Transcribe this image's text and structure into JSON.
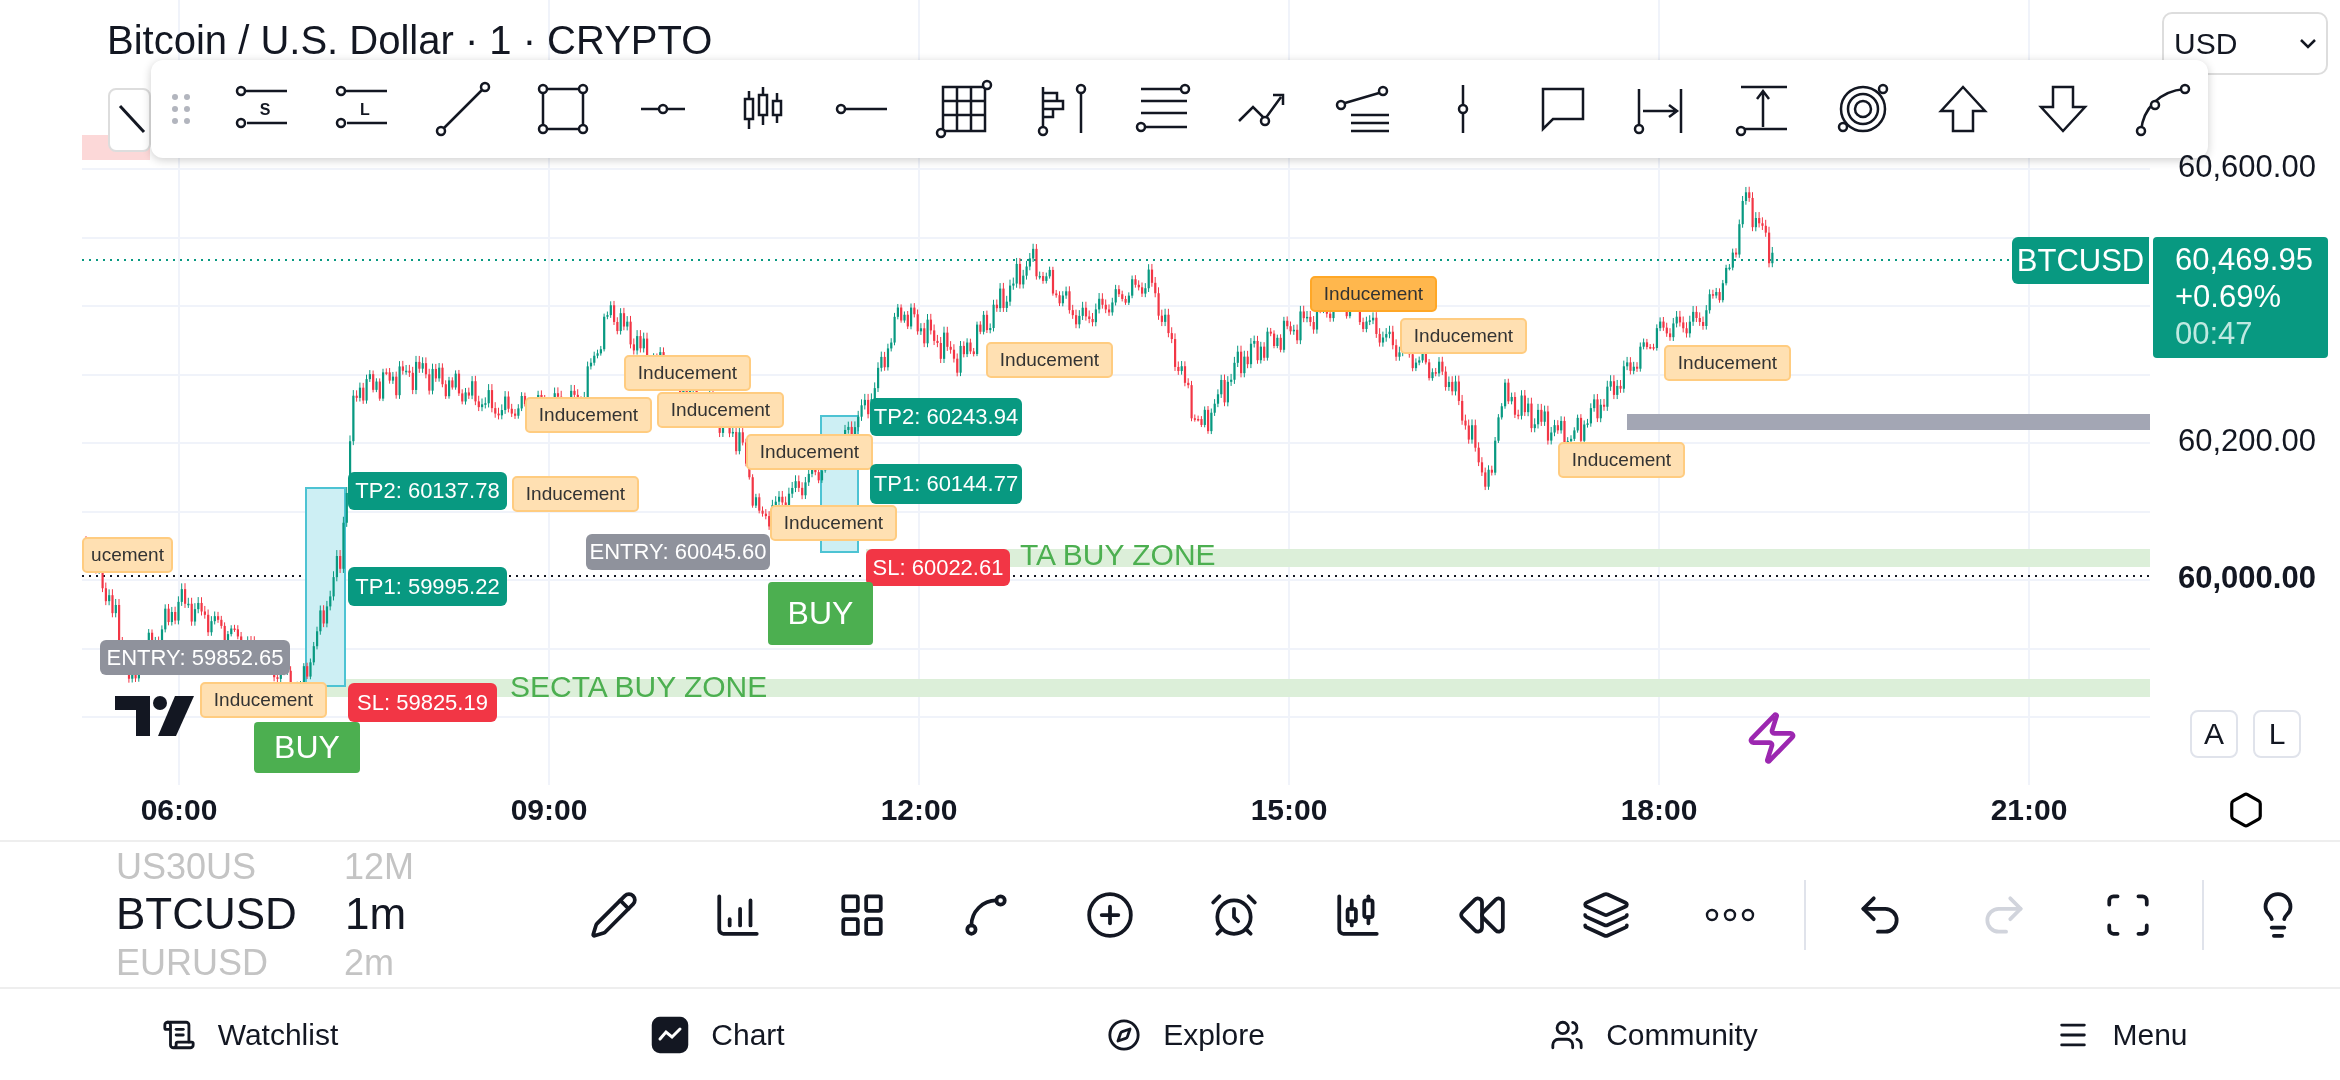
{
  "header": {
    "title": "Bitcoin / U.S. Dollar · 1 · CRYPTO",
    "currency": "USD"
  },
  "drawing_toolbar": {
    "tool_letters": [
      "S",
      "L"
    ]
  },
  "chart": {
    "symbol_tag": "BTCUSD",
    "last_price": "60,469.95",
    "change": "+0.69%",
    "countdown": "00:47",
    "price_labels": [
      {
        "text": "60,600.00",
        "bold": false
      },
      {
        "text": "60,200.00",
        "bold": false
      },
      {
        "text": "60,000.00",
        "bold": true
      }
    ],
    "time_labels": [
      "06:00",
      "09:00",
      "12:00",
      "15:00",
      "18:00",
      "21:00"
    ],
    "scale_buttons": [
      "A",
      "L"
    ],
    "zones": [
      "SECTA BUY ZONE",
      "TA BUY ZONE"
    ],
    "trade_labels": [
      {
        "kind": "tp",
        "text": "TP2: 60137.78"
      },
      {
        "kind": "tp",
        "text": "TP1: 59995.22"
      },
      {
        "kind": "sl",
        "text": "SL: 59825.19"
      },
      {
        "kind": "entry",
        "text": "ENTRY: 59852.65"
      },
      {
        "kind": "tp",
        "text": "TP2: 60243.94"
      },
      {
        "kind": "tp",
        "text": "TP1: 60144.77"
      },
      {
        "kind": "sl",
        "text": "SL: 60022.61"
      },
      {
        "kind": "entry",
        "text": "ENTRY: 60045.60"
      }
    ],
    "signals": [
      "BUY",
      "BUY"
    ],
    "inducements": [
      {
        "text": "ucement",
        "highlighted": false
      },
      {
        "text": "Inducement",
        "highlighted": false
      },
      {
        "text": "Inducement",
        "highlighted": false
      },
      {
        "text": "Inducement",
        "highlighted": false
      },
      {
        "text": "Inducement",
        "highlighted": false
      },
      {
        "text": "Inducement",
        "highlighted": false
      },
      {
        "text": "Inducement",
        "highlighted": false
      },
      {
        "text": "Inducement",
        "highlighted": false
      },
      {
        "text": "Inducement",
        "highlighted": false
      },
      {
        "text": "Inducement",
        "highlighted": true
      },
      {
        "text": "Inducement",
        "highlighted": false
      },
      {
        "text": "Inducement",
        "highlighted": false
      },
      {
        "text": "Inducement",
        "highlighted": false
      }
    ]
  },
  "symbols": [
    {
      "symbol": "US30US",
      "interval": "12M",
      "selected": false
    },
    {
      "symbol": "BTCUSD",
      "interval": "1m",
      "selected": true
    },
    {
      "symbol": "EURUSD",
      "interval": "2m",
      "selected": false
    }
  ],
  "bottom_toolbar": {
    "buttons": [
      {
        "disabled": false
      },
      {
        "disabled": false
      },
      {
        "disabled": false
      },
      {
        "disabled": false
      },
      {
        "disabled": false
      },
      {
        "disabled": false
      },
      {
        "disabled": false
      },
      {
        "disabled": false
      },
      {
        "disabled": false
      },
      {
        "disabled": false
      },
      {
        "disabled": false
      },
      {
        "disabled": true
      },
      {
        "disabled": false
      },
      {
        "disabled": false
      }
    ]
  },
  "nav": [
    {
      "label": "Watchlist",
      "selected": false
    },
    {
      "label": "Chart",
      "selected": true
    },
    {
      "label": "Explore",
      "selected": false
    },
    {
      "label": "Community",
      "selected": false
    },
    {
      "label": "Menu",
      "selected": false
    }
  ]
}
